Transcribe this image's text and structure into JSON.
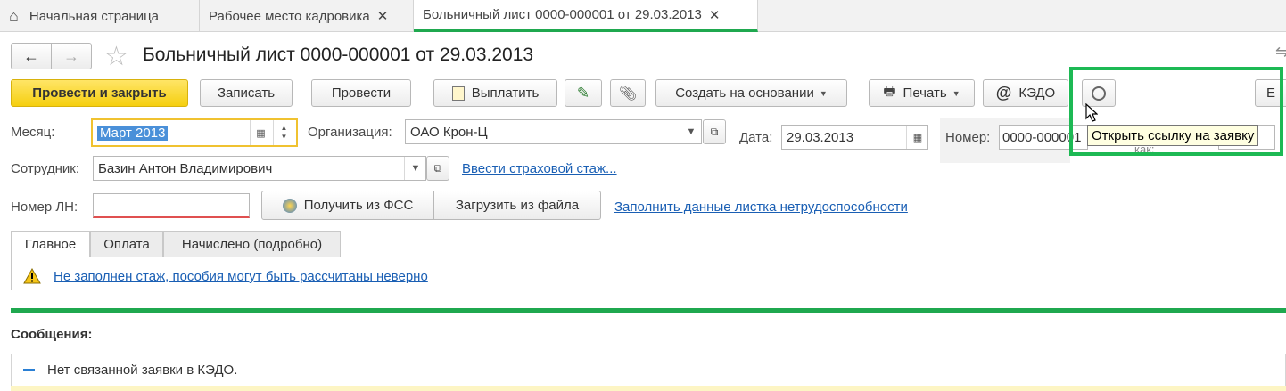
{
  "tabs": [
    {
      "label": "Начальная страница"
    },
    {
      "label": "Рабочее место кадровика"
    },
    {
      "label": "Больничный лист 0000-000001 от 29.03.2013"
    }
  ],
  "document": {
    "title": "Больничный лист 0000-000001 от 29.03.2013"
  },
  "toolbar": {
    "post_close": "Провести и закрыть",
    "save": "Записать",
    "post": "Провести",
    "pay": "Выплатить",
    "create_based": "Создать на основании",
    "print": "Печать",
    "kedo": "КЭДО",
    "more_cut": "Е"
  },
  "tooltip": {
    "text": "Открыть ссылку на заявку"
  },
  "form": {
    "month_label": "Месяц:",
    "month_value": "Март 2013",
    "org_label": "Организация:",
    "org_value": "ОАО Крон-Ц",
    "date_label": "Дата:",
    "date_value": "29.03.2013",
    "number_label": "Номер:",
    "number_value": "0000-000001",
    "number_suffix_cut": "как:",
    "employee_label": "Сотрудник:",
    "employee_value": "Базин Антон Владимирович",
    "insurance_link": "Ввести страховой стаж...",
    "ln_label": "Номер ЛН:",
    "ln_value": "",
    "fss_button": "Получить из ФСС",
    "file_button": "Загрузить из файла",
    "fill_link": "Заполнить данные листка нетрудоспособности"
  },
  "subtabs": [
    {
      "label": "Главное"
    },
    {
      "label": "Оплата"
    },
    {
      "label": "Начислено (подробно)"
    }
  ],
  "warning": {
    "text": "Не заполнен стаж, пособия могут быть рассчитаны неверно"
  },
  "messages": {
    "header": "Сообщения:",
    "items": [
      {
        "text": "Нет связанной заявки в КЭДО."
      }
    ]
  },
  "colors": {
    "accent_green": "#1fa84f",
    "primary_yellow": "#f5cf0f",
    "link_blue": "#1a5fb4",
    "highlight_box": "#1db954"
  }
}
